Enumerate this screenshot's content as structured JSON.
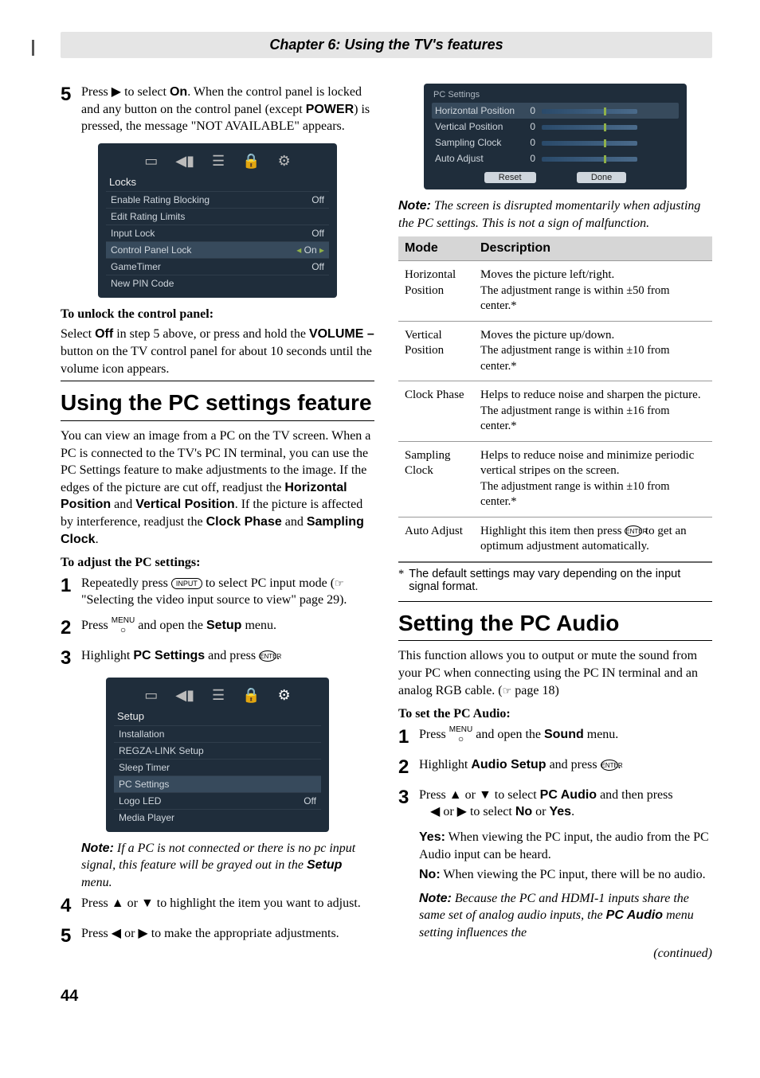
{
  "header": "Chapter 6: Using the TV's features",
  "left": {
    "step5": {
      "pre": "Press ",
      "arrow": "▶",
      "mid": " to select ",
      "on": "On",
      "post1": ". When the control panel is locked and any button on the control panel (except ",
      "power": "POWER",
      "post2": ") is pressed, the message \"NOT AVAILABLE\" appears."
    },
    "osd1": {
      "title": "Locks",
      "rows": [
        {
          "l": "Enable Rating Blocking",
          "v": "Off"
        },
        {
          "l": "Edit Rating Limits",
          "v": ""
        },
        {
          "l": "Input Lock",
          "v": "Off"
        },
        {
          "l": "Control Panel Lock",
          "v": "On",
          "hl": true,
          "arrows": true
        },
        {
          "l": "GameTimer",
          "v": "Off"
        },
        {
          "l": "New PIN Code",
          "v": ""
        }
      ]
    },
    "unlock_h": "To unlock the control panel:",
    "unlock_p_1": "Select ",
    "unlock_off": "Off",
    "unlock_p_2": " in step 5 above, or press and hold the ",
    "unlock_vol": "VOLUME –",
    "unlock_p_3": " button on the TV control panel for about 10 seconds until the volume icon appears.",
    "sec2_title": "Using the PC settings feature",
    "sec2_para": "You can view an image from a PC on the TV screen. When a PC is connected to the TV's PC IN terminal, you can use the PC Settings feature to make adjustments to the image. If the edges of the picture are cut off, readjust the ",
    "hp": "Horizontal Position",
    "sec2_and": " and ",
    "vp": "Vertical Position",
    "sec2_p2": ". If the picture is affected by interference, readjust the ",
    "cp": "Clock Phase",
    "sec2_and2": " and ",
    "sc": "Sampling Clock",
    "sec2_end": ".",
    "adjust_h": "To adjust the PC settings:",
    "s1_a": "Repeatedly press ",
    "s1_input": "INPUT",
    "s1_b": " to select PC input mode (",
    "s1_c": " \"Selecting the video input source to view\" page 29).",
    "s2_a": "Press ",
    "s2_menu_top": "MENU",
    "s2_b": " and open the ",
    "s2_setup": "Setup",
    "s2_c": " menu.",
    "s3_a": "Highlight ",
    "s3_pcs": "PC Settings",
    "s3_b": " and press ",
    "s3_enter": "ENTER",
    "s3_c": ".",
    "osd2": {
      "title": "Setup",
      "rows": [
        {
          "l": "Installation"
        },
        {
          "l": "REGZA-LINK Setup"
        },
        {
          "l": "Sleep Timer"
        },
        {
          "l": "PC Settings",
          "hl": true
        },
        {
          "l": "Logo LED",
          "v": "Off"
        },
        {
          "l": "Media Player"
        }
      ]
    },
    "note1_pre": "Note:",
    "note1": " If a PC is not connected or there is no pc input signal, this feature will be grayed out in the ",
    "note1_setup": "Setup",
    "note1_end": " menu.",
    "s4_a": "Press ",
    "s4_up": "▲",
    "s4_or": " or ",
    "s4_dn": "▼",
    "s4_b": " to highlight the item you want to adjust.",
    "s5_a": "Press ",
    "s5_l": "◀",
    "s5_or": " or ",
    "s5_r": "▶",
    "s5_b": " to make the appropriate adjustments."
  },
  "right": {
    "osd3": {
      "title": "PC Settings",
      "rows": [
        {
          "l": "Horizontal Position",
          "v": "0",
          "hl": true
        },
        {
          "l": "Vertical Position",
          "v": "0"
        },
        {
          "l": "Sampling Clock",
          "v": "0"
        },
        {
          "l": "Auto Adjust",
          "v": "0"
        }
      ],
      "btnReset": "Reset",
      "btnDone": "Done"
    },
    "note2_pre": "Note:",
    "note2": " The screen is disrupted momentarily when adjusting the PC settings. This is not a sign of malfunction.",
    "tbl": {
      "h1": "Mode",
      "h2": "Description",
      "rows": [
        {
          "m": "Horizontal Position",
          "d1": "Moves the picture left/right.",
          "d2": "The adjustment range is within ±50 from center.*"
        },
        {
          "m": "Vertical Position",
          "d1": "Moves the picture up/down.",
          "d2": "The adjustment range is within ±10 from center.*"
        },
        {
          "m": "Clock Phase",
          "d1": "Helps to reduce noise and sharpen the picture.",
          "d2": "The adjustment range is within ±16 from center.*"
        },
        {
          "m": "Sampling Clock",
          "d1": "Helps to reduce noise and minimize periodic vertical stripes on the screen.",
          "d2": "The adjustment range is within ±10 from center.*"
        },
        {
          "m": "Auto Adjust",
          "d1pre": "Highlight this item then press ",
          "d1enter": "ENTER",
          "d1post": " to get an optimum adjustment automatically.",
          "d2": ""
        }
      ]
    },
    "footnote_star": "*",
    "footnote": "The default settings may vary depending on the input signal format.",
    "sec3_title": "Setting the PC Audio",
    "sec3_p1": "This function allows you to output or mute the sound from your PC when connecting using the PC IN terminal and an analog RGB cable. (",
    "sec3_p1b": " page 18)",
    "setpc_h": "To set the PC Audio:",
    "r1_a": "Press ",
    "r1_b": " and open the ",
    "r1_sound": "Sound",
    "r1_c": " menu.",
    "r2_a": "Highlight ",
    "r2_as": "Audio Setup",
    "r2_b": " and press ",
    "r2_c": ".",
    "r3_a": "Press ",
    "r3_up": "▲",
    "r3_or": " or ",
    "r3_dn": "▼",
    "r3_b": " to select ",
    "r3_pca": "PC Audio",
    "r3_c": " and then press ",
    "r3_l": "◀",
    "r3_or2": " or ",
    "r3_r": "▶",
    "r3_d": " to select ",
    "r3_no": "No",
    "r3_or3": " or ",
    "r3_yes": "Yes",
    "r3_e": ".",
    "yes": "Yes:",
    "yes_t": " When viewing the PC input, the audio from the PC Audio input can be heard.",
    "no": "No:",
    "no_t": " When viewing the PC input, there will be no audio.",
    "note3_pre": "Note:",
    "note3": " Because the PC and HDMI-1 inputs share the same set of analog audio inputs, the ",
    "note3_pca": "PC Audio",
    "note3_end": " menu setting influences the",
    "continued": "(continued)"
  },
  "pagenum": "44"
}
